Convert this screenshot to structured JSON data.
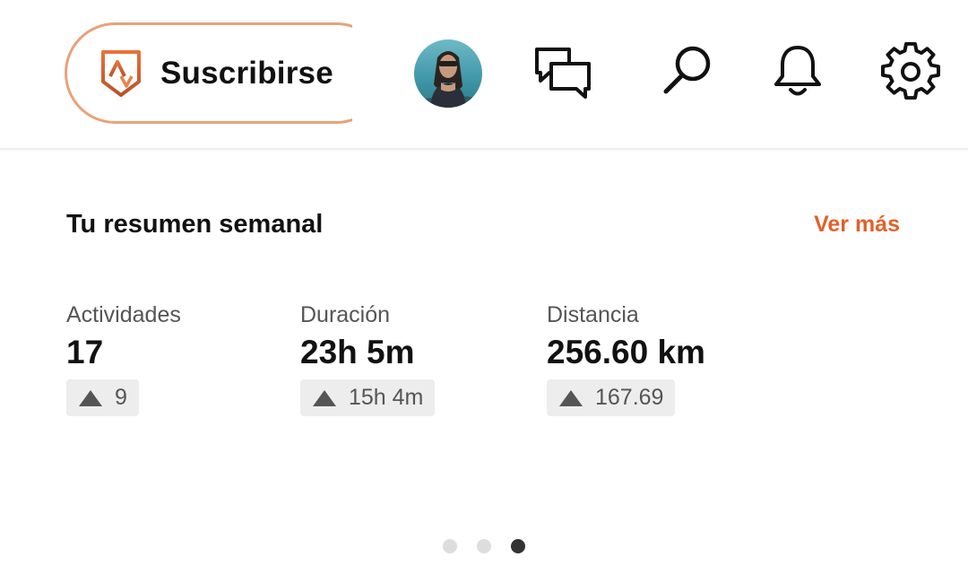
{
  "header": {
    "subscribe_label": "Suscribirse",
    "icons": [
      "strava-subscription-icon",
      "messages-icon",
      "search-icon",
      "bell-icon",
      "gear-icon"
    ]
  },
  "summary": {
    "title": "Tu resumen semanal",
    "see_more": "Ver más",
    "stats": [
      {
        "label": "Actividades",
        "value": "17",
        "delta": "9"
      },
      {
        "label": "Duración",
        "value": "23h 5m",
        "delta": "15h 4m"
      },
      {
        "label": "Distancia",
        "value": "256.60 km",
        "delta": "167.69"
      }
    ]
  },
  "carousel": {
    "page_count": 3,
    "active_page": 3
  },
  "colors": {
    "accent": "#e0612c",
    "subscribe_border": "#e9a27a",
    "delta_bg": "#ededed",
    "dot_inactive": "#dddddd",
    "dot_active": "#333333"
  }
}
